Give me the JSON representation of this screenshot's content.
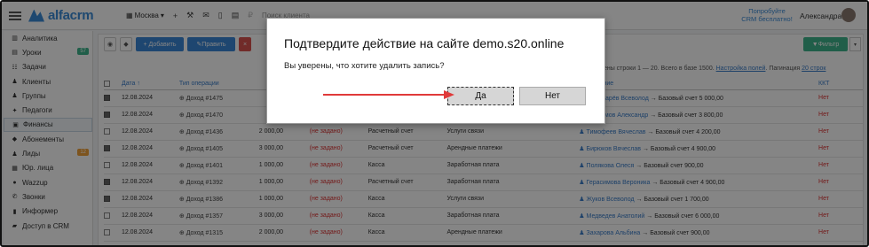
{
  "topbar": {
    "logo": "alfacrm",
    "branch": "Москва",
    "search_placeholder": "Поиск клиента",
    "promo": "Попробуйте CRM бесплатно!",
    "user_name": "Александра",
    "icons": [
      "plus-icon",
      "wrench-icon",
      "mail-icon",
      "phone-icon",
      "calendar-icon",
      "ruble-icon"
    ]
  },
  "sidebar": {
    "items": [
      {
        "label": "Аналитика",
        "icon": "chart-icon"
      },
      {
        "label": "Уроки",
        "icon": "calendar-icon",
        "badge": "57",
        "badge_color": "#3fb58c"
      },
      {
        "label": "Задачи",
        "icon": "tasks-icon"
      },
      {
        "label": "Клиенты",
        "icon": "user-icon"
      },
      {
        "label": "Группы",
        "icon": "users-icon"
      },
      {
        "label": "Педагоги",
        "icon": "teacher-icon"
      },
      {
        "label": "Финансы",
        "icon": "money-icon",
        "active": true
      },
      {
        "label": "Абонементы",
        "icon": "tag-icon"
      },
      {
        "label": "Лиды",
        "icon": "leads-icon",
        "badge": "12",
        "badge_color": "#f0a23a"
      },
      {
        "label": "Юр. лица",
        "icon": "building-icon"
      },
      {
        "label": "Wazzup",
        "icon": "chat-icon"
      },
      {
        "label": "Звонки",
        "icon": "phone-icon"
      },
      {
        "label": "Информер",
        "icon": "informer-icon"
      },
      {
        "label": "Доступ в CRM",
        "icon": "lock-icon"
      }
    ]
  },
  "toolbar": {
    "add_label": "+ Добавить",
    "edit_label": "Править",
    "filter_label": "Фильтр"
  },
  "info": {
    "shown": "Отображены строки 1 — 20. Всего в базе 1500.",
    "settings": "Настройка полей",
    "pagination_label": "Пагинация",
    "pagination_value": "20 строк"
  },
  "table": {
    "headers": {
      "date": "Дата ↑",
      "op": "Тип операции",
      "target": "Назначение",
      "kkt": "ККТ"
    },
    "rows": [
      {
        "checked": true,
        "date": "12.08.2024",
        "op": "Доход #1475",
        "sum": "",
        "kkt_missing": "",
        "account": "",
        "category": "",
        "target": "Пономарёв Всеволод",
        "target_rest": " → Базовый счет 5 000,00",
        "kkt": "Нет"
      },
      {
        "checked": true,
        "date": "12.08.2024",
        "op": "Доход #1470",
        "sum": "",
        "kkt_missing": "",
        "account": "",
        "category": "",
        "target": "Максимов Александр",
        "target_rest": " → Базовый счет 3 800,00",
        "kkt": "Нет"
      },
      {
        "checked": false,
        "date": "12.08.2024",
        "op": "Доход #1436",
        "sum": "2 000,00",
        "kkt_missing": "(не задано)",
        "account": "Расчетный счет",
        "category": "Услуги связи",
        "target": "Тимофеев Вячеслав",
        "target_rest": " → Базовый счет 4 200,00",
        "kkt": "Нет"
      },
      {
        "checked": true,
        "date": "12.08.2024",
        "op": "Доход #1405",
        "sum": "3 000,00",
        "kkt_missing": "(не задано)",
        "account": "Расчетный счет",
        "category": "Арендные платежи",
        "target": "Бирюков Вячеслав",
        "target_rest": " → Базовый счет 4 900,00",
        "kkt": "Нет"
      },
      {
        "checked": false,
        "date": "12.08.2024",
        "op": "Доход #1401",
        "sum": "1 000,00",
        "kkt_missing": "(не задано)",
        "account": "Касса",
        "category": "Заработная плата",
        "target": "Полякова Олеся",
        "target_rest": " → Базовый счет 900,00",
        "kkt": "Нет"
      },
      {
        "checked": true,
        "date": "12.08.2024",
        "op": "Доход #1392",
        "sum": "1 000,00",
        "kkt_missing": "(не задано)",
        "account": "Расчетный счет",
        "category": "Заработная плата",
        "target": "Герасимова Вероника",
        "target_rest": " → Базовый счет 4 900,00",
        "kkt": "Нет"
      },
      {
        "checked": true,
        "date": "12.08.2024",
        "op": "Доход #1386",
        "sum": "1 000,00",
        "kkt_missing": "(не задано)",
        "account": "Касса",
        "category": "Услуги связи",
        "target": "Жуков Всеволод",
        "target_rest": " → Базовый счет 1 700,00",
        "kkt": "Нет"
      },
      {
        "checked": false,
        "date": "12.08.2024",
        "op": "Доход #1357",
        "sum": "3 000,00",
        "kkt_missing": "(не задано)",
        "account": "Касса",
        "category": "Заработная плата",
        "target": "Медведев Анатолий",
        "target_rest": " → Базовый счет 6 000,00",
        "kkt": "Нет"
      },
      {
        "checked": false,
        "date": "12.08.2024",
        "op": "Доход #1315",
        "sum": "2 000,00",
        "kkt_missing": "(не задано)",
        "account": "Касса",
        "category": "Арендные платежи",
        "target": "Захарова Альбина",
        "target_rest": " → Базовый счет 900,00",
        "kkt": "Нет"
      }
    ]
  },
  "dialog": {
    "title": "Подтвердите действие на сайте demo.s20.online",
    "message": "Вы уверены, что хотите удалить запись?",
    "yes_label": "Да",
    "no_label": "Нет",
    "arrow_color": "#e03a3a"
  }
}
